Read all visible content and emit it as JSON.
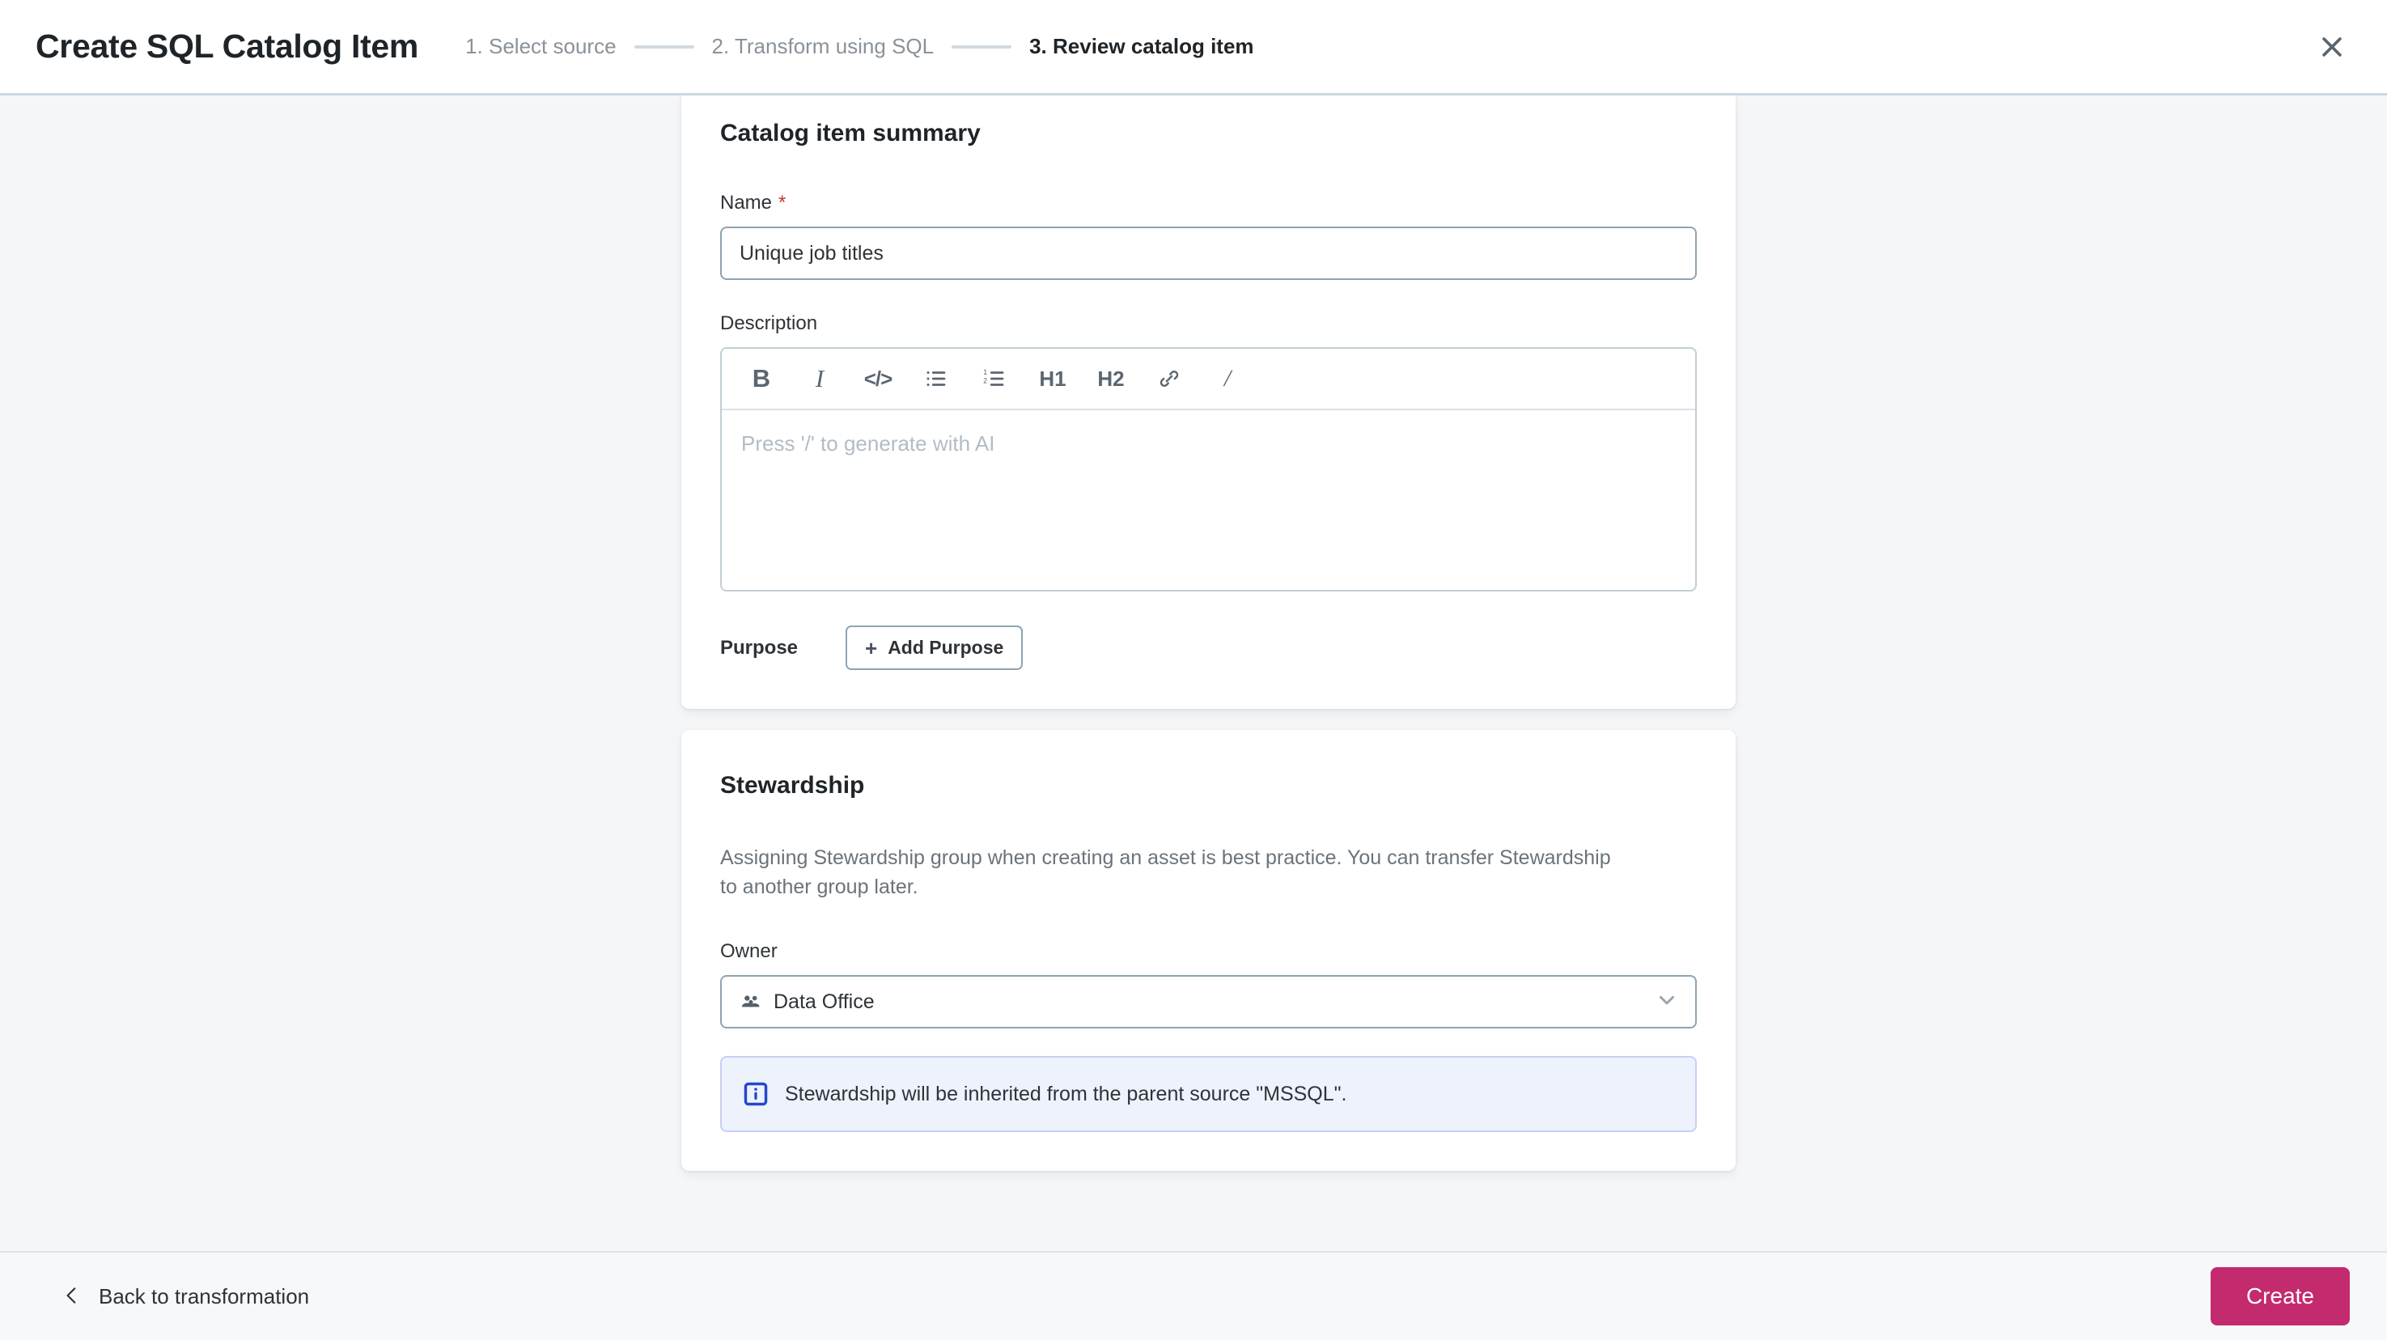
{
  "header": {
    "title": "Create SQL Catalog Item",
    "steps": [
      {
        "label": "1. Select source",
        "active": false
      },
      {
        "label": "2. Transform using SQL",
        "active": false
      },
      {
        "label": "3. Review catalog item",
        "active": true
      }
    ],
    "close_label": "close-icon"
  },
  "summary_card": {
    "title": "Catalog item summary",
    "name_label": "Name",
    "required_marker": "*",
    "name_value": "Unique job titles",
    "name_placeholder": "Name",
    "description_label": "Description",
    "editor": {
      "placeholder": "Press '/' to generate with AI",
      "toolbar": [
        {
          "name": "bold-icon",
          "glyph": "B"
        },
        {
          "name": "italic-icon",
          "glyph": "I"
        },
        {
          "name": "code-icon",
          "glyph": "</>"
        },
        {
          "name": "bullet-list-icon",
          "glyph": ""
        },
        {
          "name": "numbered-list-icon",
          "glyph": ""
        },
        {
          "name": "heading-1-icon",
          "glyph": "H1"
        },
        {
          "name": "heading-2-icon",
          "glyph": "H2"
        },
        {
          "name": "link-icon",
          "glyph": ""
        },
        {
          "name": "slash-command-icon",
          "glyph": "/"
        }
      ]
    },
    "purpose_label": "Purpose",
    "add_purpose_label": "Add Purpose",
    "add_purpose_plus": "+"
  },
  "stewardship_card": {
    "title": "Stewardship",
    "description": "Assigning Stewardship group when creating an asset is best practice. You can transfer Stewardship to another group later.",
    "owner_label": "Owner",
    "owner_value": "Data Office",
    "info_message": "Stewardship will be inherited from the parent source \"MSSQL\"."
  },
  "footer": {
    "back_label": "Back to transformation",
    "create_label": "Create"
  },
  "colors": {
    "accent": "#c42a6e",
    "page_background": "#f4f6f8",
    "info_background": "#eef2fd",
    "info_border": "#c6d0f5",
    "info_icon": "#2348cc",
    "required_star": "#c0392b",
    "input_border": "#8ea4b2",
    "step_inactive": "#8a9299",
    "step_active": "#1f2428"
  }
}
